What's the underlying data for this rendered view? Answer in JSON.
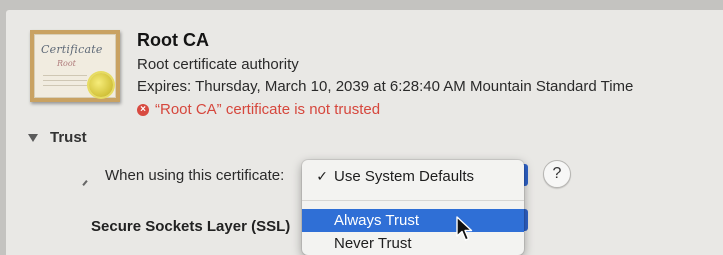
{
  "certificate": {
    "name": "Root CA",
    "kind": "Root certificate authority",
    "expires": "Expires: Thursday, March 10, 2039 at 6:28:40 AM Mountain Standard Time",
    "status": "“Root CA” certificate is not trusted",
    "icon": {
      "script_text": "Certificate",
      "sub_text": "Root"
    }
  },
  "trust": {
    "section_label": "Trust",
    "when_using_label": "When using this certificate:",
    "popup": {
      "selected": "Use System Defaults",
      "checkmark": "✓",
      "options": [
        "Always Trust",
        "Never Trust"
      ],
      "highlighted": "Always Trust"
    },
    "help_label": "?",
    "ssl_label": "Secure Sockets Layer (SSL)"
  },
  "colors": {
    "status_red": "#d6473d",
    "highlight_blue": "#2f6fd6"
  }
}
